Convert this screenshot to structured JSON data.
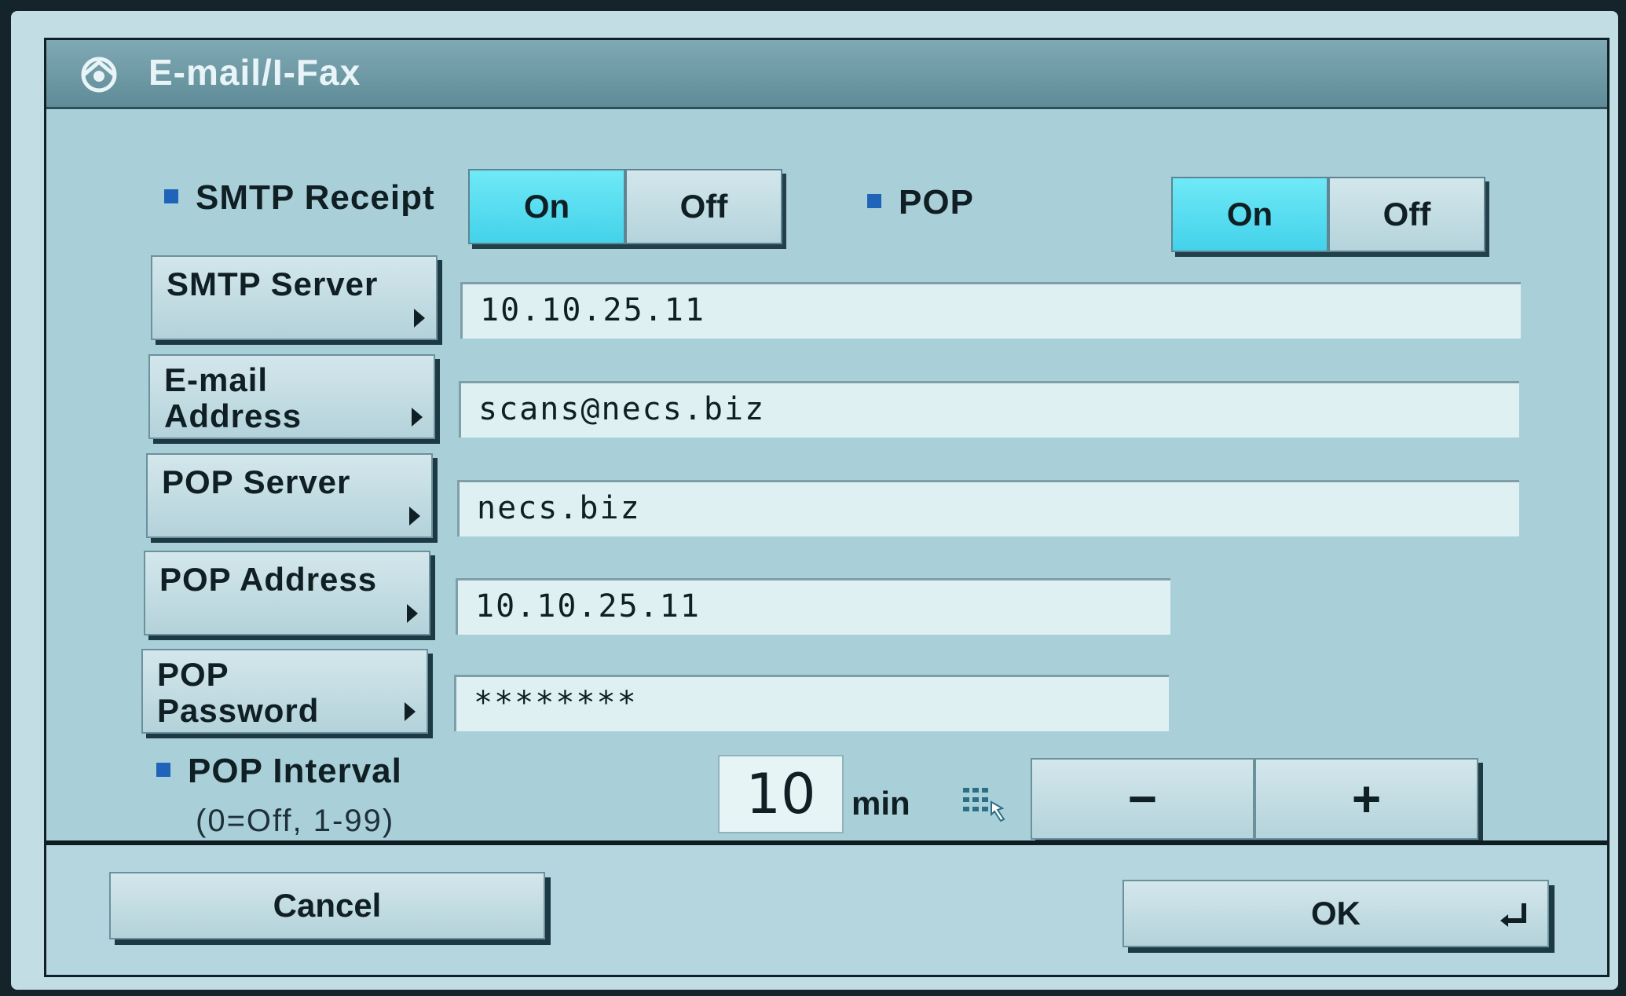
{
  "window": {
    "title": "E-mail/I-Fax",
    "icon": "network-icon"
  },
  "smtp_receipt": {
    "label": "SMTP Receipt",
    "on_label": "On",
    "off_label": "Off",
    "selected": "On"
  },
  "pop": {
    "label": "POP",
    "on_label": "On",
    "off_label": "Off",
    "selected": "On"
  },
  "fields": {
    "smtp_server": {
      "button_label": "SMTP Server",
      "value": "10.10.25.11"
    },
    "email_address": {
      "button_label": "E-mail\nAddress",
      "value": "scans@necs.biz"
    },
    "pop_server": {
      "button_label": "POP Server",
      "value": "necs.biz"
    },
    "pop_address": {
      "button_label": "POP Address",
      "value": "10.10.25.11"
    },
    "pop_password": {
      "button_label": "POP\nPassword",
      "value": "********"
    }
  },
  "pop_interval": {
    "label": "POP Interval",
    "hint": "(0=Off, 1-99)",
    "value": "10",
    "unit": "min",
    "minus_label": "−",
    "plus_label": "+"
  },
  "footer": {
    "cancel_label": "Cancel",
    "ok_label": "OK"
  },
  "colors": {
    "selected_toggle": "#43d2ea",
    "background": "#a9cfd9",
    "bullet": "#1f64b8"
  }
}
